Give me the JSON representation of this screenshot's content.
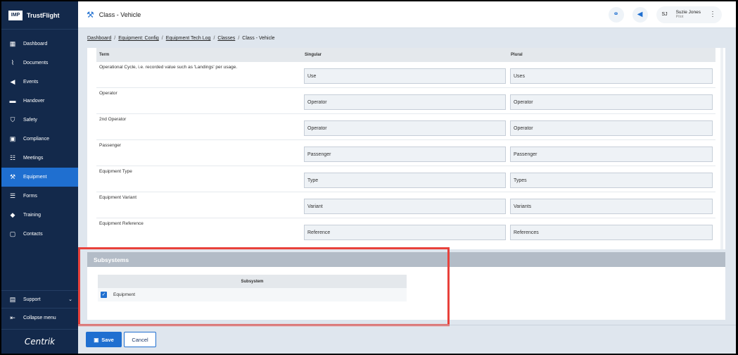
{
  "brand": {
    "logo": "IMP",
    "name": "TrustFlight"
  },
  "sidebar": {
    "items": [
      {
        "label": "Dashboard",
        "icon": "dashboard-icon"
      },
      {
        "label": "Documents",
        "icon": "paperclip-icon"
      },
      {
        "label": "Events",
        "icon": "megaphone-icon"
      },
      {
        "label": "Handover",
        "icon": "inbox-icon"
      },
      {
        "label": "Safety",
        "icon": "shield-icon"
      },
      {
        "label": "Compliance",
        "icon": "clipboard-icon"
      },
      {
        "label": "Meetings",
        "icon": "people-icon"
      },
      {
        "label": "Equipment",
        "icon": "wrench-icon",
        "active": true
      },
      {
        "label": "Forms",
        "icon": "forms-icon"
      },
      {
        "label": "Training",
        "icon": "graduation-cap-icon"
      },
      {
        "label": "Contacts",
        "icon": "contact-card-icon"
      }
    ],
    "support_label": "Support",
    "collapse_label": "Collapse menu",
    "footer_logo": "Centrik"
  },
  "header": {
    "title": "Class - Vehicle",
    "user_initials": "SJ",
    "user_name": "Suzie Jones",
    "user_role": "Pilot"
  },
  "breadcrumb": {
    "items": [
      "Dashboard",
      "Equipment: Config",
      "Equipment Tech Log",
      "Classes"
    ],
    "current": "Class - Vehicle"
  },
  "terms": {
    "headers": {
      "term": "Term",
      "singular": "Singular",
      "plural": "Plural"
    },
    "rows": [
      {
        "term": "Operational Cycle, i.e. recorded value such as 'Landings' per usage.",
        "singular": "Use",
        "plural": "Uses"
      },
      {
        "term": "Operator",
        "singular": "Operator",
        "plural": "Operator"
      },
      {
        "term": "2nd Operator",
        "singular": "Operator",
        "plural": "Operator"
      },
      {
        "term": "Passenger",
        "singular": "Passenger",
        "plural": "Passenger"
      },
      {
        "term": "Equipment Type",
        "singular": "Type",
        "plural": "Types"
      },
      {
        "term": "Equipment Variant",
        "singular": "Variant",
        "plural": "Variants"
      },
      {
        "term": "Equipment Reference",
        "singular": "Reference",
        "plural": "References"
      }
    ]
  },
  "subsystems": {
    "title": "Subsystems",
    "column": "Subsystem",
    "rows": [
      {
        "label": "Equipment",
        "checked": true
      }
    ]
  },
  "footer": {
    "save_label": "Save",
    "cancel_label": "Cancel"
  },
  "colors": {
    "accent": "#1f6fd0",
    "sidebar": "#13294b",
    "highlight": "#e8413b"
  }
}
